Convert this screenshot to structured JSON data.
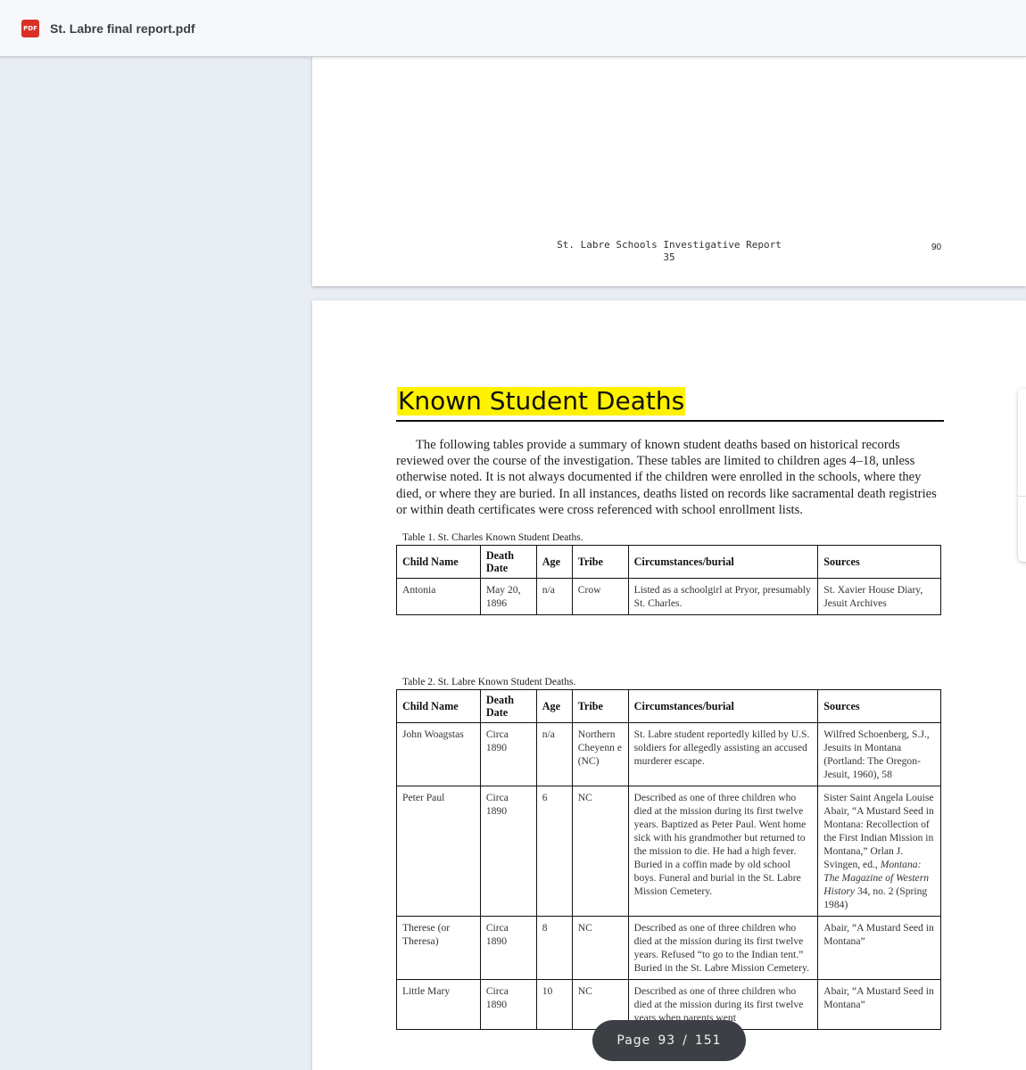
{
  "app": {
    "file_icon_label": "PDF",
    "file_name": "St. Labre final report.pdf"
  },
  "previous_page": {
    "footer_title": "St. Labre Schools Investigative Report",
    "footer_sub": "35",
    "page_number": "90"
  },
  "current_page": {
    "heading": "Known Student Deaths",
    "intro": "The following tables provide a summary of known student deaths based on historical records reviewed over the course of the investigation. These tables are limited to children ages 4–18, unless otherwise noted. It is not always documented if the children were enrolled in the schools, where they died, or where they are buried. In all instances, deaths listed on records like sacramental death registries or within death certificates were cross referenced with school enrollment lists.",
    "columns": [
      "Child Name",
      "Death Date",
      "Age",
      "Tribe",
      "Circumstances/burial",
      "Sources"
    ],
    "table1": {
      "caption": "Table 1. St. Charles Known Student Deaths.",
      "rows": [
        {
          "name": "Antonia",
          "date": "May 20, 1896",
          "age": "n/a",
          "tribe": "Crow",
          "circumstances": "Listed as a schoolgirl at Pryor, presumably St. Charles.",
          "sources": "St. Xavier House Diary, Jesuit Archives"
        }
      ]
    },
    "table2": {
      "caption": "Table 2. St. Labre Known Student Deaths.",
      "rows": [
        {
          "name": "John Woagstas",
          "date": "Circa 1890",
          "age": "n/a",
          "tribe": "Northern Cheyenn e (NC)",
          "circumstances": "St. Labre student reportedly killed by U.S. soldiers for allegedly assisting an accused murderer escape.",
          "sources": "Wilfred Schoenberg, S.J., Jesuits in Montana (Portland: The Oregon-Jesuit, 1960), 58"
        },
        {
          "name": "Peter Paul",
          "date": "Circa 1890",
          "age": "6",
          "tribe": "NC",
          "circumstances": "Described as one of three children who died at the mission during its first twelve years. Baptized as Peter Paul. Went home sick with his grandmother but returned to the mission to die. He had a high fever. Buried in a coffin made by old school boys. Funeral and burial in the St. Labre Mission Cemetery.",
          "sources_pre": "Sister Saint Angela Louise Abair, “A Mustard Seed in Montana: Recollection of the First Indian Mission in Montana,” Orlan J. Svingen, ed.,",
          "sources_ital": "Montana: The Magazine of Western History",
          "sources_post": "34, no. 2 (Spring 1984)"
        },
        {
          "name": "Therese (or Theresa)",
          "date": "Circa 1890",
          "age": "8",
          "tribe": "NC",
          "circumstances": "Described as one of three children who died at the mission during its first twelve years. Refused “to go to the Indian tent.” Buried in the St. Labre Mission Cemetery.",
          "sources": "Abair, “A Mustard Seed in Montana”"
        },
        {
          "name": "Little Mary",
          "date": "Circa 1890",
          "age": "10",
          "tribe": "NC",
          "circumstances": "Described as one of three children who died at the mission during its first twelve years when parents went",
          "sources": "Abair, “A Mustard Seed in Montana”"
        }
      ]
    }
  },
  "viewer": {
    "page_label": "Page",
    "current": "93",
    "separator": "/",
    "total": "151"
  }
}
